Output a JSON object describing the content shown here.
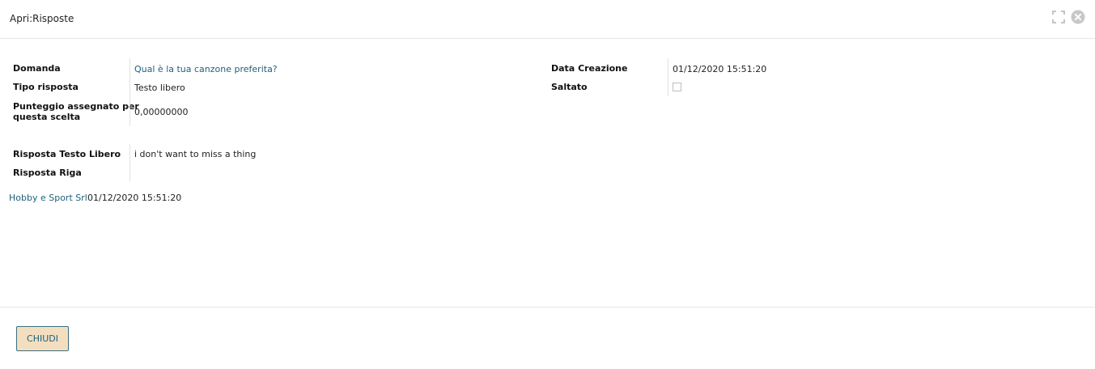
{
  "window": {
    "title": "Apri:Risposte"
  },
  "form": {
    "left": {
      "domanda_label": "Domanda",
      "domanda_value": "Qual è la tua canzone preferita?",
      "tipo_label": "Tipo risposta",
      "tipo_value": "Testo libero",
      "punteggio_label_line1": "Punteggio assegnato per",
      "punteggio_label_line2": "questa scelta",
      "punteggio_value": "0,00000000"
    },
    "right": {
      "data_label": "Data Creazione",
      "data_value": "01/12/2020 15:51:20",
      "saltato_label": "Saltato",
      "saltato_checked": false
    },
    "answers": {
      "testo_label": "Risposta Testo Libero",
      "testo_value": "i don't want to miss a thing",
      "riga_label": "Risposta Riga",
      "riga_value": ""
    }
  },
  "footer_info": {
    "company": "Hobby e Sport Srl",
    "timestamp": "01/12/2020 15:51:20"
  },
  "buttons": {
    "close_label": "CHIUDI"
  },
  "colors": {
    "link": "#1f5f7a",
    "button_bg": "#f3dfc0",
    "button_border": "#3b6f80"
  },
  "icons": {
    "expand": "expand-icon",
    "close": "close-circle-icon"
  }
}
